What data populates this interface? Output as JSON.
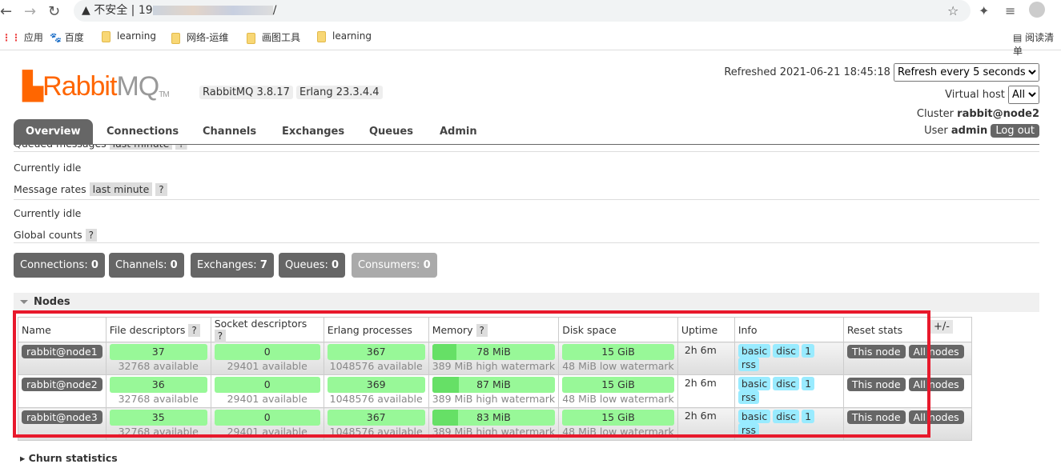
{
  "browser": {
    "security": "不安全",
    "url_prefix": "19",
    "url_suffix": "/",
    "bookmarks": [
      "应用",
      "百度",
      "learning",
      "网络-运维",
      "画图工具",
      "learning"
    ],
    "reader": "阅读清单"
  },
  "header": {
    "logo": "RabbitMQ",
    "version": "RabbitMQ 3.8.17",
    "erlang": "Erlang 23.3.4.4",
    "refreshed": "Refreshed 2021-06-21 18:45:18",
    "refresh_select": "Refresh every 5 seconds",
    "vhost_label": "Virtual host",
    "vhost_select": "All",
    "cluster_label": "Cluster",
    "cluster": "rabbit@node2",
    "user_label": "User",
    "user": "admin",
    "logout": "Log out"
  },
  "tabs": [
    "Overview",
    "Connections",
    "Channels",
    "Exchanges",
    "Queues",
    "Admin"
  ],
  "overview": {
    "queued": "Queued messages",
    "last_minute": "last minute",
    "help": "?",
    "idle1": "Currently idle",
    "rates": "Message rates",
    "idle2": "Currently idle",
    "global": "Global counts"
  },
  "counts": [
    {
      "label": "Connections:",
      "value": "0"
    },
    {
      "label": "Channels:",
      "value": "0"
    },
    {
      "label": "Exchanges:",
      "value": "7"
    },
    {
      "label": "Queues:",
      "value": "0"
    },
    {
      "label": "Consumers:",
      "value": "0"
    }
  ],
  "nodes": {
    "title": "Nodes",
    "columns": [
      "Name",
      "File descriptors",
      "Socket descriptors",
      "Erlang processes",
      "Memory",
      "Disk space",
      "Uptime",
      "Info",
      "Reset stats"
    ],
    "plusminus": "+/-",
    "rows": [
      {
        "name": "rabbit@node1",
        "fd": "37",
        "fd_avail": "32768 available",
        "sd": "0",
        "sd_avail": "29401 available",
        "ep": "367",
        "ep_avail": "1048576 available",
        "mem": "78 MiB",
        "mem_frac": 0.2,
        "mem_sub": "389 MiB high watermark",
        "disk": "15 GiB",
        "disk_sub": "48 MiB low watermark",
        "uptime": "2h 6m",
        "info": [
          "basic",
          "disc",
          "1",
          "rss"
        ],
        "this": "This node",
        "all": "All nodes"
      },
      {
        "name": "rabbit@node2",
        "fd": "36",
        "fd_avail": "32768 available",
        "sd": "0",
        "sd_avail": "29401 available",
        "ep": "369",
        "ep_avail": "1048576 available",
        "mem": "87 MiB",
        "mem_frac": 0.22,
        "mem_sub": "389 MiB high watermark",
        "disk": "15 GiB",
        "disk_sub": "48 MiB low watermark",
        "uptime": "2h 6m",
        "info": [
          "basic",
          "disc",
          "1",
          "rss"
        ],
        "this": "This node",
        "all": "All nodes"
      },
      {
        "name": "rabbit@node3",
        "fd": "35",
        "fd_avail": "32768 available",
        "sd": "0",
        "sd_avail": "29401 available",
        "ep": "367",
        "ep_avail": "1048576 available",
        "mem": "83 MiB",
        "mem_frac": 0.21,
        "mem_sub": "389 MiB high watermark",
        "disk": "15 GiB",
        "disk_sub": "48 MiB low watermark",
        "uptime": "2h 6m",
        "info": [
          "basic",
          "disc",
          "1",
          "rss"
        ],
        "this": "This node",
        "all": "All nodes"
      }
    ]
  },
  "churn": "Churn statistics",
  "colors": {
    "accent": "#ff6600",
    "bar": "#98f898",
    "highlight": "#e8192c"
  }
}
